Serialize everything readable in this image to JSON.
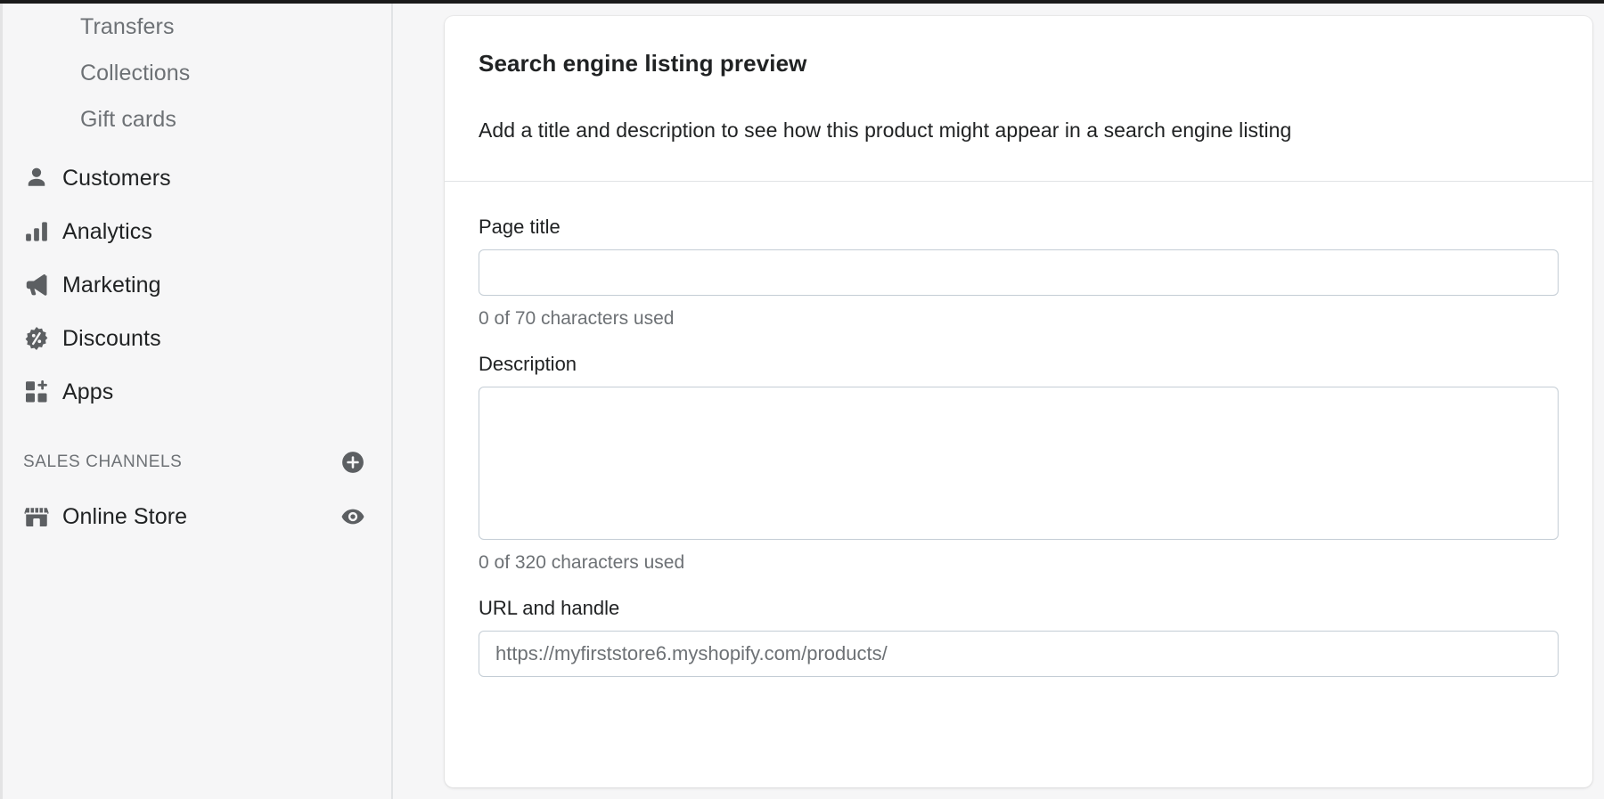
{
  "sidebar": {
    "nav_items": [
      {
        "label": "Transfers",
        "icon": "",
        "sub": true
      },
      {
        "label": "Collections",
        "icon": "",
        "sub": true
      },
      {
        "label": "Gift cards",
        "icon": "",
        "sub": true
      },
      {
        "label": "Customers",
        "icon": "person-icon",
        "sub": false
      },
      {
        "label": "Analytics",
        "icon": "bar-chart-icon",
        "sub": false
      },
      {
        "label": "Marketing",
        "icon": "megaphone-icon",
        "sub": false
      },
      {
        "label": "Discounts",
        "icon": "discount-badge-icon",
        "sub": false
      },
      {
        "label": "Apps",
        "icon": "apps-plus-icon",
        "sub": false
      }
    ],
    "sales_channels": {
      "title": "SALES CHANNELS",
      "add_icon": "plus-circle-icon",
      "items": [
        {
          "label": "Online Store",
          "icon": "storefront-icon",
          "action_icon": "eye-icon"
        }
      ]
    }
  },
  "main": {
    "card": {
      "title": "Search engine listing preview",
      "subtitle": "Add a title and description to see how this product might appear in a search engine listing",
      "fields": {
        "page_title": {
          "label": "Page title",
          "value": "",
          "placeholder": "",
          "helper": "0 of 70 characters used"
        },
        "description": {
          "label": "Description",
          "value": "",
          "placeholder": "",
          "helper": "0 of 320 characters used"
        },
        "url_handle": {
          "label": "URL and handle",
          "value": "https://myfirststore6.myshopify.com/products/",
          "placeholder": "https://myfirststore6.myshopify.com/products/"
        }
      }
    }
  },
  "colors": {
    "page_bg": "#f6f6f7",
    "card_bg": "#ffffff",
    "text_primary": "#202223",
    "text_subdued": "#6d7175",
    "border": "#e1e3e5",
    "input_border": "#c4cdd5"
  }
}
